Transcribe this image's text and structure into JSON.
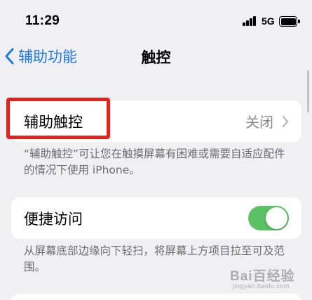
{
  "status_bar": {
    "time": "11:29",
    "network": "5G"
  },
  "nav": {
    "back_label": "辅助功能",
    "title": "触控"
  },
  "assistive_touch": {
    "label": "辅助触控",
    "value": "关闭",
    "footer": "“辅助触控”可让您在触摸屏幕有困难或需要自适应配件的情况下使用 iPhone。"
  },
  "reachability": {
    "label": "便捷访问",
    "enabled": true,
    "footer": "从屏幕底部边缘向下轻扫，将屏幕上方项目拉至可及范围。"
  },
  "colors": {
    "accent": "#1f7ae0",
    "toggle_on": "#5ac164",
    "highlight": "#e8201a",
    "background": "#efeff4"
  },
  "watermark": {
    "text": "Bai百经验",
    "subtext": "jingyan.baidu.com"
  }
}
